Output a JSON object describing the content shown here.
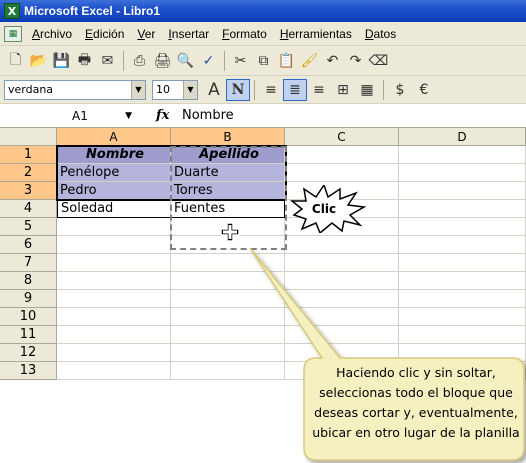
{
  "window": {
    "title": "Microsoft Excel - Libro1",
    "app_icon": "X"
  },
  "menubar": {
    "items": [
      "Archivo",
      "Edición",
      "Ver",
      "Insertar",
      "Formato",
      "Herramientas",
      "Datos"
    ]
  },
  "toolbar": {
    "icons": [
      "new-icon",
      "open-icon",
      "save-icon",
      "permissions-icon",
      "email-icon",
      "print-preview-icon",
      "print-icon",
      "search-icon",
      "spelling-icon",
      "cut-icon",
      "copy-icon",
      "paste-icon",
      "format-painter-icon",
      "undo-icon",
      "redo-icon",
      "eraser-icon"
    ]
  },
  "formatbar": {
    "font": "verdana",
    "size": "10",
    "buttons": [
      "grow-font-icon",
      "bold-icon",
      "align-left-icon",
      "align-center-icon",
      "align-right-icon",
      "merge-icon",
      "borders-icon",
      "currency-icon",
      "euro-icon"
    ],
    "grow_font_glyph": "A",
    "bold_glyph": "N",
    "currency_glyph": "$",
    "euro_glyph": "€"
  },
  "formula_bar": {
    "name_box": "A1",
    "fx_label": "fx",
    "content": "Nombre"
  },
  "grid": {
    "columns": [
      "A",
      "B",
      "C",
      "D"
    ],
    "rows": [
      "1",
      "2",
      "3",
      "4",
      "5",
      "6",
      "7",
      "8",
      "9",
      "10",
      "11",
      "12",
      "13"
    ],
    "cells": [
      [
        "Nombre",
        "Apellido"
      ],
      [
        "Penélope",
        "Duarte"
      ],
      [
        "Pedro",
        "Torres"
      ],
      [
        "Soledad",
        "Fuentes"
      ]
    ],
    "selection": "A1:B3"
  },
  "callouts": {
    "clic": "Clic",
    "tooltip": "Haciendo clic y sin soltar, seleccionas todo el bloque que deseas cortar y, eventualmente, ubicar en otro lugar de la planilla"
  },
  "colors": {
    "selection": "#b4b4dc",
    "header_highlight": "#ffc88a",
    "tooltip_fill": "#f4f0c0",
    "titlebar": "#0a3cb8"
  }
}
